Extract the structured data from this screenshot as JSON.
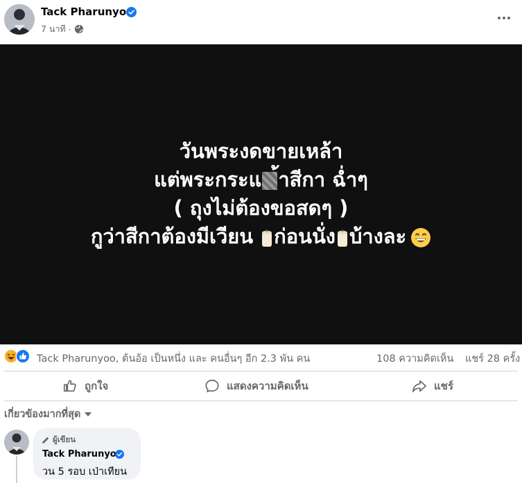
{
  "post": {
    "author": "Tack Pharunyoo",
    "time": "7 นาที",
    "meta_separator": "·",
    "image_text": {
      "line1": "วันพระงดขายเหล้า",
      "line2_before": "แต่พระกระแ",
      "line2_after": "้าสีกา ฉ่ำๆ",
      "line3": "( ถุงไม่ต้องขอสดๆ )",
      "line4_a": "กูว่าสีกาต้องมีเวียน ",
      "line4_b": "ก่อนนั่ง",
      "line4_c": "บ้างละ"
    }
  },
  "stats": {
    "reactors": "Tack Pharunyoo, ต้นอ้อ เป็นหนึ่ง และ คนอื่นๆ อีก 2.3 พัน คน",
    "comments": "108 ความคิดเห็น",
    "shares": "แชร์ 28 ครั้ง"
  },
  "actions": {
    "like": "ถูกใจ",
    "comment": "แสดงความคิดเห็น",
    "share": "แชร์"
  },
  "comments_section": {
    "sort_label": "เกี่ยวข้องมากที่สุด",
    "comment": {
      "badge": "ผู้เขียน",
      "author": "Tack Pharunyoo",
      "text": "วน 5 รอบ เป่าเทียน"
    }
  },
  "colors": {
    "verified": "#1877f2",
    "like_blue": "#1877f2",
    "haha_yellow": "#f7b125",
    "secondary_text": "#65676b",
    "image_bg": "#101010"
  },
  "icons": [
    "verified-badge-icon",
    "globe-icon",
    "more-icon",
    "haha-reaction-icon",
    "like-reaction-icon",
    "like-icon",
    "comment-icon",
    "share-icon",
    "pencil-icon",
    "candle-icon",
    "grinning-face-icon"
  ]
}
